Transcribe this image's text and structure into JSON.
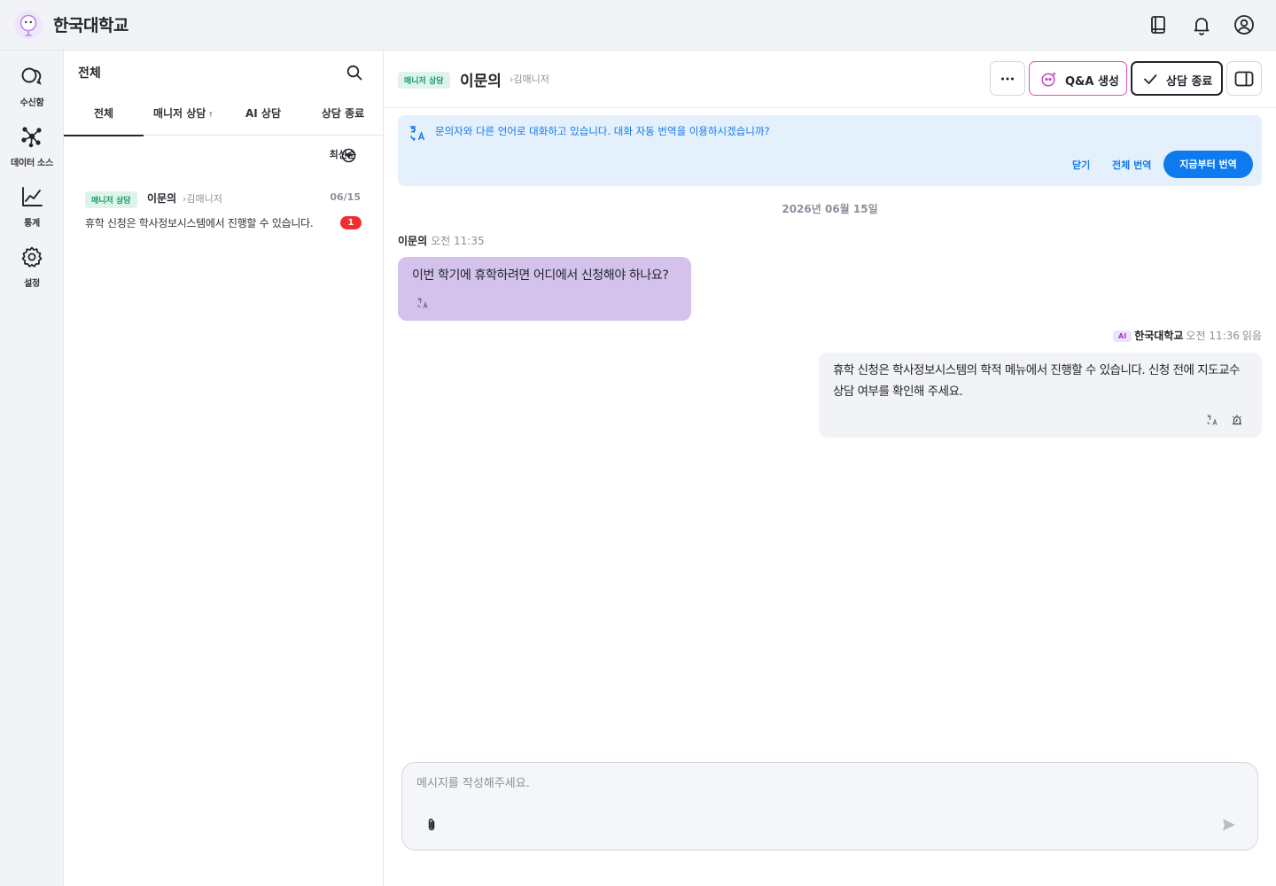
{
  "app": {
    "brand": "한국대학교"
  },
  "topbar": {
    "icons": [
      "book-icon",
      "bell-icon",
      "user-circle-icon"
    ]
  },
  "rail": {
    "items": [
      {
        "label": "수신함",
        "icon": "chat-bubbles-icon"
      },
      {
        "label": "데이터 소스",
        "icon": "network-icon"
      },
      {
        "label": "통계",
        "icon": "line-chart-icon"
      },
      {
        "label": "설정",
        "icon": "gear-icon"
      }
    ]
  },
  "list": {
    "title": "전체",
    "tabs": [
      {
        "label": "전체",
        "active": true
      },
      {
        "label": "매니저 상담",
        "sort_glyph": "↑"
      },
      {
        "label": "AI 상담"
      },
      {
        "label": "상담 종료"
      }
    ],
    "sort_label": "최신순",
    "conversations": [
      {
        "badge": "매니저 상담",
        "name": "이문의",
        "manager": "김매니저",
        "date": "06/15",
        "preview": "휴학 신청은 학사정보시스템에서 진행할 수 있습니다.",
        "unread": "1"
      }
    ]
  },
  "chat": {
    "badge": "매니저 상담",
    "name": "이문의",
    "manager": "김매니저",
    "buttons": {
      "more": "more-icon",
      "qa": "Q&A 생성",
      "end": "상담 종료",
      "panel": "panel-toggle-icon"
    },
    "banner": {
      "message": "문의자와 다른 언어로 대화하고 있습니다. 대화 자동 번역을 이용하시겠습니까?",
      "close": "닫기",
      "translate_all": "전체 번역",
      "translate_now": "지금부터 번역"
    },
    "date": "2026년 06월 15일",
    "messages": [
      {
        "sender": "이문의",
        "time": "오전 11:35",
        "text": "이번 학기에 휴학하려면 어디에서 신청해야 하나요?"
      },
      {
        "badge": "AI",
        "sender": "한국대학교",
        "time": "오전 11:36",
        "status": "읽음",
        "text": "휴학 신청은 학사정보시스템의 학적 메뉴에서 진행할 수 있습니다. 신청 전에 지도교수 상담 여부를 확인해 주세요."
      }
    ],
    "composer": {
      "placeholder": "메시지를 작성해주세요."
    }
  },
  "colors": {
    "accent_blue": "#0e7af0",
    "manager_badge_green": "#179a68",
    "incoming_bubble": "#d4c2ec",
    "unread_red": "#ef2e2e",
    "qa_border": "#e04fb8"
  }
}
